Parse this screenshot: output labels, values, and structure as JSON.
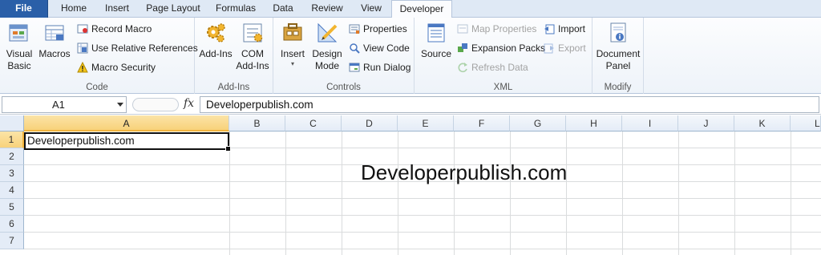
{
  "tabs": [
    "File",
    "Home",
    "Insert",
    "Page Layout",
    "Formulas",
    "Data",
    "Review",
    "View",
    "Developer"
  ],
  "active_tab": "Developer",
  "ribbon": {
    "code": {
      "label": "Code",
      "visual_basic": [
        "Visual",
        "Basic"
      ],
      "macros": "Macros",
      "record_macro": "Record Macro",
      "use_relative": "Use Relative References",
      "macro_security": "Macro Security"
    },
    "addins": {
      "label": "Add-Ins",
      "add_ins": "Add-Ins",
      "com_add_ins": [
        "COM",
        "Add-Ins"
      ]
    },
    "controls": {
      "label": "Controls",
      "insert": "Insert",
      "design_mode": [
        "Design",
        "Mode"
      ],
      "properties": "Properties",
      "view_code": "View Code",
      "run_dialog": "Run Dialog"
    },
    "xml": {
      "label": "XML",
      "source": "Source",
      "map_properties": "Map Properties",
      "expansion_packs": "Expansion Packs",
      "refresh_data": "Refresh Data",
      "import": "Import",
      "export": "Export"
    },
    "modify": {
      "label": "Modify",
      "document_panel": [
        "Document",
        "Panel"
      ]
    }
  },
  "formula_bar": {
    "name_box": "A1",
    "fx": "fx",
    "formula": "Developerpublish.com"
  },
  "columns": [
    "A",
    "B",
    "C",
    "D",
    "E",
    "F",
    "G",
    "H",
    "I",
    "J",
    "K",
    "L"
  ],
  "rows": [
    "1",
    "2",
    "3",
    "4",
    "5",
    "6",
    "7"
  ],
  "cells": {
    "A1": "Developerpublish.com"
  },
  "overlay_text": "Developerpublish.com",
  "colors": {
    "file_tab": "#2a5fa8",
    "selection_header": "#f8d27a",
    "ribbon_bg": "#eef3f9"
  }
}
